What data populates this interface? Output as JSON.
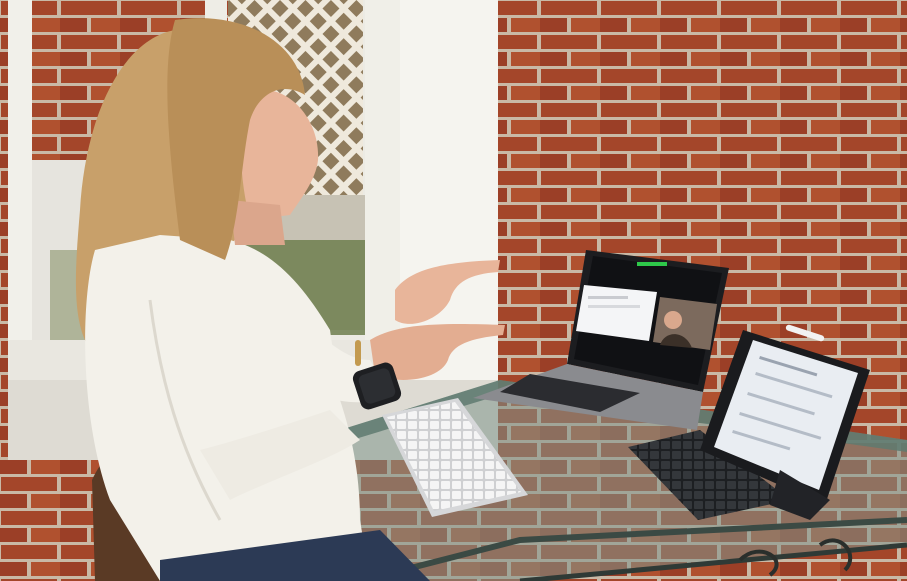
{
  "scene": {
    "description_free": true,
    "colors": {
      "brick": "#a4462a",
      "mortar": "#c9b9a6",
      "window_frame": "#ecebe4",
      "shirt": "#f3f1ea",
      "hair": "#c8a06a",
      "skin": "#e8b59a",
      "laptop": "#6e6e72",
      "table_glass": "#5f7a70"
    },
    "icons": [
      "laptop-icon",
      "tablet-icon",
      "keyboard-icon",
      "watch-icon"
    ]
  }
}
